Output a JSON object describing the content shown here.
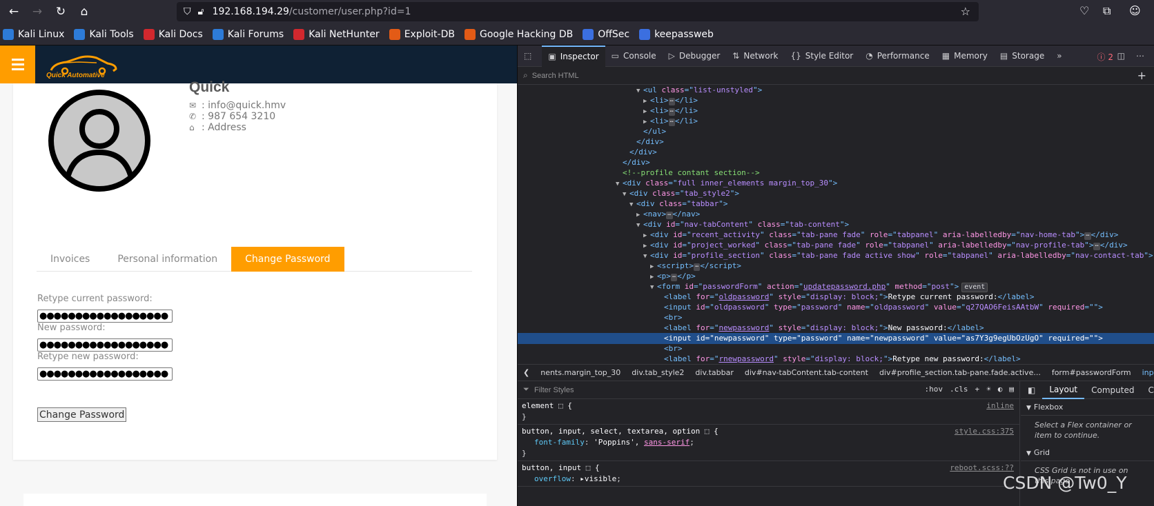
{
  "browser": {
    "url_host": "192.168.194.29",
    "url_path": "/customer/user.php?id=1",
    "bookmarks": [
      "Kali Linux",
      "Kali Tools",
      "Kali Docs",
      "Kali Forums",
      "Kali NetHunter",
      "Exploit-DB",
      "Google Hacking DB",
      "OffSec",
      "keepassweb"
    ],
    "bookmark_colors": [
      "#2d7bd8",
      "#2d7bd8",
      "#d2282e",
      "#2d7bd8",
      "#d2282e",
      "#e35b16",
      "#e35b16",
      "#3b6fe0",
      "#3b6fe0"
    ]
  },
  "site": {
    "logo_text": "Quick Automative",
    "profile_name": "Quick",
    "email": ": info@quick.hmv",
    "phone": ": 987 654 3210",
    "address": ": Address",
    "tabs": [
      "Invoices",
      "Personal information",
      "Change Password"
    ],
    "active_tab": "Change Password",
    "fields": [
      {
        "label": "Retype current password:",
        "value": "●●●●●●●●●●●●●●●●●●"
      },
      {
        "label": "New password:",
        "value": "●●●●●●●●●●●●●●●●●●"
      },
      {
        "label": "Retype new password:",
        "value": "●●●●●●●●●●●●●●●●●●"
      }
    ],
    "submit_label": "Change Password",
    "accent": "#ff9d00"
  },
  "devtools": {
    "tabs": [
      "Inspector",
      "Console",
      "Debugger",
      "Network",
      "Style Editor",
      "Performance",
      "Memory",
      "Storage"
    ],
    "error_count": "2",
    "search_placeholder": "Search HTML",
    "breadcrumbs": [
      "nents.margin_top_30",
      "div.tab_style2",
      "div.tabbar",
      "div#nav-tabContent.tab-content",
      "div#profile_section.tab-pane.fade.active...",
      "form#passwordForm",
      "input#newpassword"
    ],
    "filter_placeholder": "Filter Styles",
    "filter_buttons": [
      ":hov",
      ".cls"
    ],
    "layout_tabs": [
      "Layout",
      "Computed",
      "Cha"
    ],
    "flexbox_title": "Flexbox",
    "flexbox_note": "Select a Flex container or item to continue.",
    "grid_title": "Grid",
    "grid_note": "CSS Grid is not in use on this page",
    "rules": [
      {
        "selector": "element ⬚ {",
        "source": "inline",
        "decls": [],
        "close": "}"
      },
      {
        "selector": "button, input, select, textarea, option ⬚ {",
        "source": "style.css:375",
        "decls": [
          {
            "p": "font-family",
            "v": "'Poppins', ",
            "u": "sans-serif",
            "end": ";"
          }
        ],
        "close": "}"
      },
      {
        "selector": "button, input ⬚ {",
        "source": "reboot.scss:??",
        "decls": [
          {
            "p": "overflow",
            "v": "▸visible",
            "u": "",
            "end": ";"
          }
        ],
        "close": ""
      }
    ]
  },
  "watermark": "CSDN @Tw0_Y"
}
